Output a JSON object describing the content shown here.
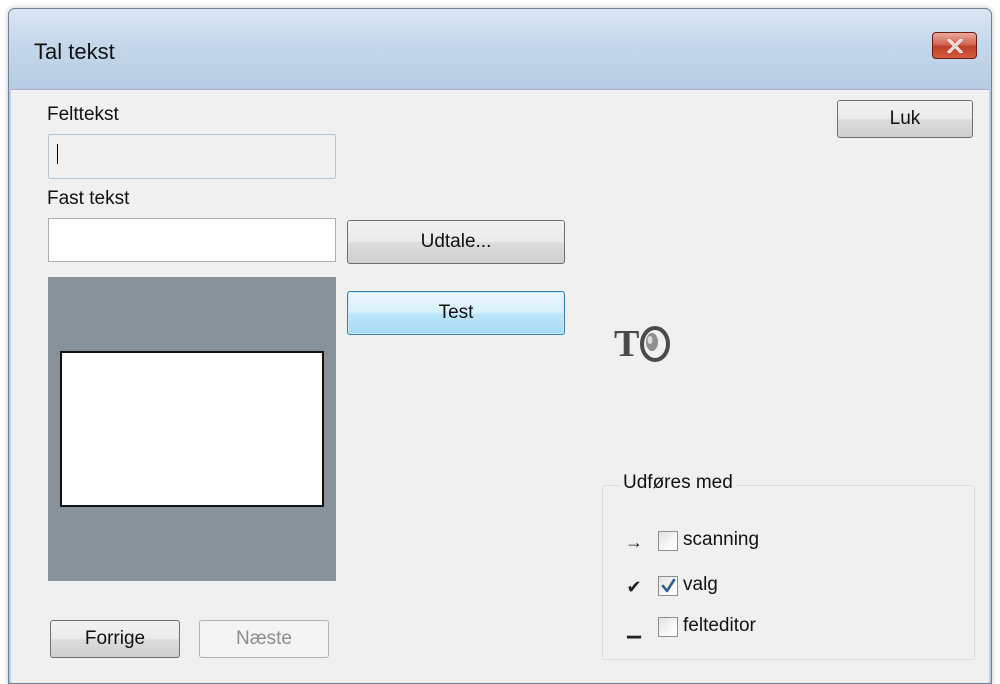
{
  "window": {
    "title": "Tal tekst",
    "close_icon": "close-icon"
  },
  "fields": {
    "field_text_label": "Felttekst",
    "field_text_value": "",
    "fixed_text_label": "Fast tekst",
    "fixed_text_value": ""
  },
  "buttons": {
    "close": "Luk",
    "pronounce": "Udtale...",
    "test": "Test",
    "previous": "Forrige",
    "next": "Næste"
  },
  "tts_icon": "text-to-speech-icon",
  "execution": {
    "title": "Udføres med",
    "options": [
      {
        "symbol": "→",
        "icon": "arrow-right-icon",
        "label": "scanning",
        "checked": false
      },
      {
        "symbol": "✔",
        "icon": "checkmark-icon",
        "label": "valg",
        "checked": true
      },
      {
        "symbol": "▁",
        "icon": "underscore-icon",
        "label": "felteditor",
        "checked": false
      }
    ]
  }
}
